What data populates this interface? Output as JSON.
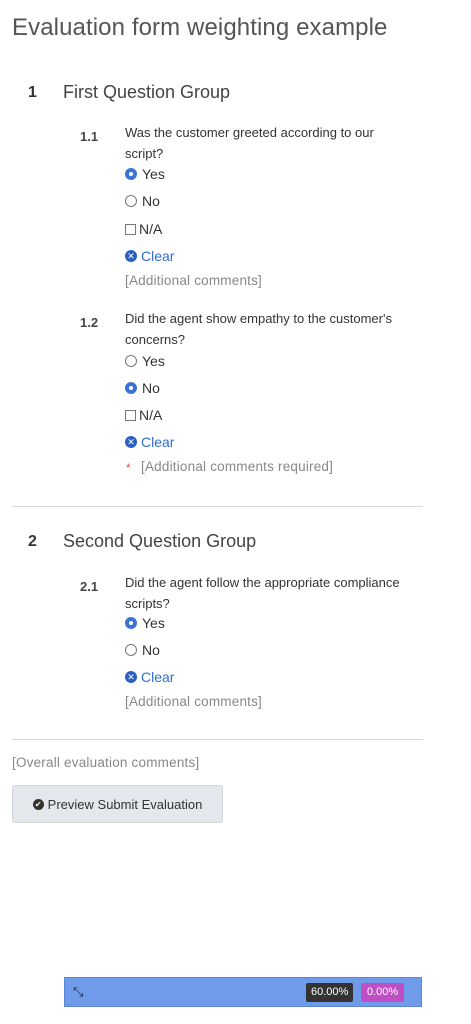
{
  "page_title": "Evaluation form weighting example",
  "groups": [
    {
      "number": "1",
      "title": "First Question Group",
      "questions": [
        {
          "number": "1.1",
          "text": "Was the customer greeted according to our script?",
          "options": [
            {
              "label": "Yes",
              "type": "radio",
              "checked": true
            },
            {
              "label": "No",
              "type": "radio",
              "checked": false
            },
            {
              "label": "N/A",
              "type": "checkbox",
              "checked": false
            }
          ],
          "clear_label": "Clear",
          "comments_placeholder": "[Additional comments]"
        },
        {
          "number": "1.2",
          "text": "Did the agent show empathy to the customer's concerns?",
          "options": [
            {
              "label": "Yes",
              "type": "radio",
              "checked": false
            },
            {
              "label": "No",
              "type": "radio",
              "checked": true
            },
            {
              "label": "N/A",
              "type": "checkbox",
              "checked": false
            }
          ],
          "clear_label": "Clear",
          "required_marker": "*",
          "comments_placeholder": "[Additional comments required]"
        }
      ]
    },
    {
      "number": "2",
      "title": "Second Question Group",
      "questions": [
        {
          "number": "2.1",
          "text": "Did the agent follow the appropriate compliance scripts?",
          "options": [
            {
              "label": "Yes",
              "type": "radio",
              "checked": true
            },
            {
              "label": "No",
              "type": "radio",
              "checked": false
            }
          ],
          "clear_label": "Clear",
          "comments_placeholder": "[Additional comments]"
        }
      ]
    }
  ],
  "overall_comments_placeholder": "[Overall evaluation comments]",
  "preview_button_label": "Preview Submit Evaluation",
  "status_bar": {
    "score_badge": "60.00%",
    "critical_badge": "0.00%"
  },
  "colors": {
    "accent": "#3a73d6",
    "link": "#2f6fd0",
    "required": "#e0504a",
    "status_bar": "#6f9bea",
    "badge_purple": "#c04ec4"
  },
  "icons": {
    "clear": "times-circle-icon",
    "preview": "check-circle-icon",
    "resize": "resize-icon"
  }
}
